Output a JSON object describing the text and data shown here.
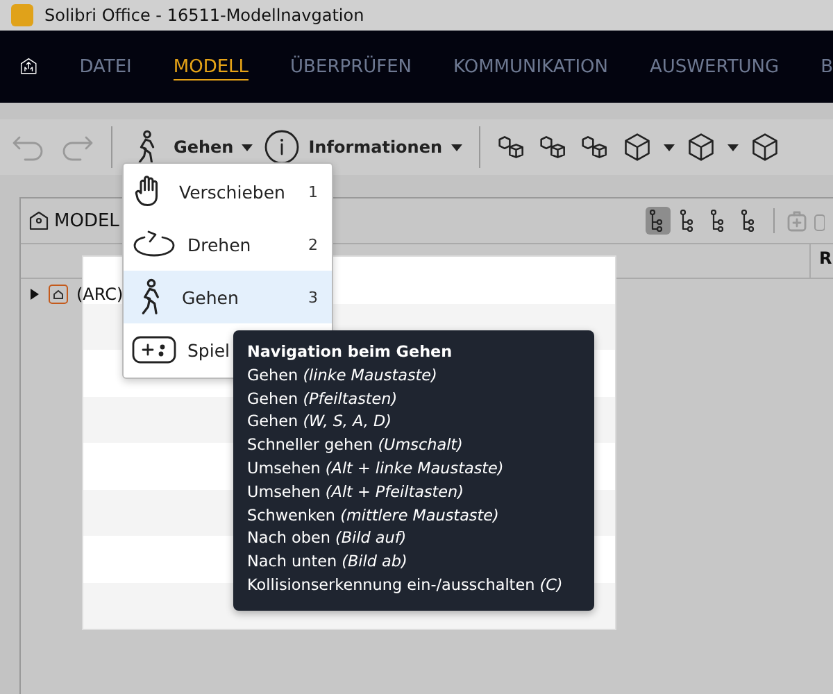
{
  "window": {
    "title": "Solibri Office - 16511-Modellnavgation"
  },
  "tabs": [
    {
      "label": "DATEI",
      "selected": false
    },
    {
      "label": "MODELL",
      "selected": true
    },
    {
      "label": "ÜBERPRÜFEN",
      "selected": false
    },
    {
      "label": "KOMMUNIKATION",
      "selected": false
    },
    {
      "label": "AUSWERTUNG",
      "selected": false
    },
    {
      "label": "B",
      "selected": false
    }
  ],
  "toolbar": {
    "navigation_button": "Gehen",
    "info_button": "Informationen"
  },
  "panel": {
    "title": "MODEL",
    "column_header": "R",
    "tree_rows": [
      {
        "label": "(ARC)",
        "expanded": false
      }
    ]
  },
  "navigation_menu": [
    {
      "label": "Verschieben",
      "shortcut": "1",
      "selected": false,
      "kind": "hand"
    },
    {
      "label": "Drehen",
      "shortcut": "2",
      "selected": false,
      "kind": "rotate"
    },
    {
      "label": "Gehen",
      "shortcut": "3",
      "selected": true,
      "kind": "walk"
    },
    {
      "label": "Spiel",
      "selected": false,
      "kind": "gamepad"
    }
  ],
  "tooltip": {
    "title": "Navigation beim Gehen",
    "lines": [
      "Gehen *(linke Maustaste)*",
      "Gehen *(Pfeiltasten)*",
      "Gehen *(W, S, A, D)*",
      "Schneller gehen *(Umschalt)*",
      "Umsehen *(Alt + linke Maustaste)*",
      "Umsehen *(Alt + Pfeiltasten)*",
      "Schwenken *(mittlere Maustaste)*",
      "Nach oben *(Bild auf)*",
      "Nach unten *(Bild ab)*",
      "Kollisionserkennung ein-/ausschalten *(C)*"
    ]
  }
}
